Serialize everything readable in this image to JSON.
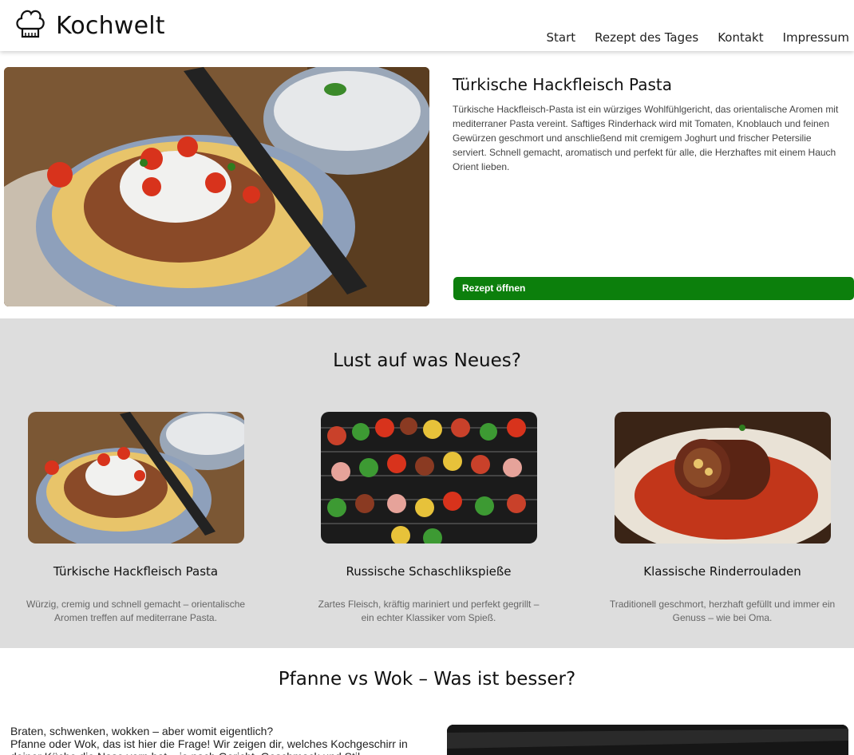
{
  "header": {
    "brand": "Kochwelt",
    "nav": [
      "Start",
      "Rezept des Tages",
      "Kontakt",
      "Impressum"
    ]
  },
  "featured": {
    "title": "Türkische Hackfleisch Pasta",
    "description": "Türkische Hackfleisch-Pasta ist ein würziges Wohlfühlgericht, das orientalische Aromen mit mediterraner Pasta vereint. Saftiges Rinderhack wird mit Tomaten, Knoblauch und feinen Gewürzen geschmort und anschließend mit cremigem Joghurt und frischer Petersilie serviert. Schnell gemacht, aromatisch und perfekt für alle, die Herzhaftes mit einem Hauch Orient lieben.",
    "button": "Rezept öffnen"
  },
  "suggestions": {
    "heading": "Lust auf was Neues?",
    "cards": [
      {
        "title": "Türkische Hackfleisch Pasta",
        "description": "Würzig, cremig und schnell gemacht – orientalische Aromen treffen auf mediterrane Pasta."
      },
      {
        "title": "Russische Schaschlikspieße",
        "description": "Zartes Fleisch, kräftig mariniert und perfekt gegrillt – ein echter Klassiker vom Spieß."
      },
      {
        "title": "Klassische Rinderrouladen",
        "description": "Traditionell geschmort, herzhaft gefüllt und immer ein Genuss – wie bei Oma."
      }
    ]
  },
  "article": {
    "heading": "Pfanne vs Wok – Was ist besser?",
    "line1": "Braten, schwenken, wokken – aber womit eigentlich?",
    "line2": "Pfanne oder Wok, das ist hier die Frage! Wir zeigen dir, welches Kochgeschirr in deiner Küche die Nase vorn hat – je nach Gericht, Geschmack und Stil."
  },
  "colors": {
    "accent": "#0c7f0c",
    "section_bg": "#dddddd"
  },
  "icons": {
    "logo": "chef-hat-icon"
  }
}
